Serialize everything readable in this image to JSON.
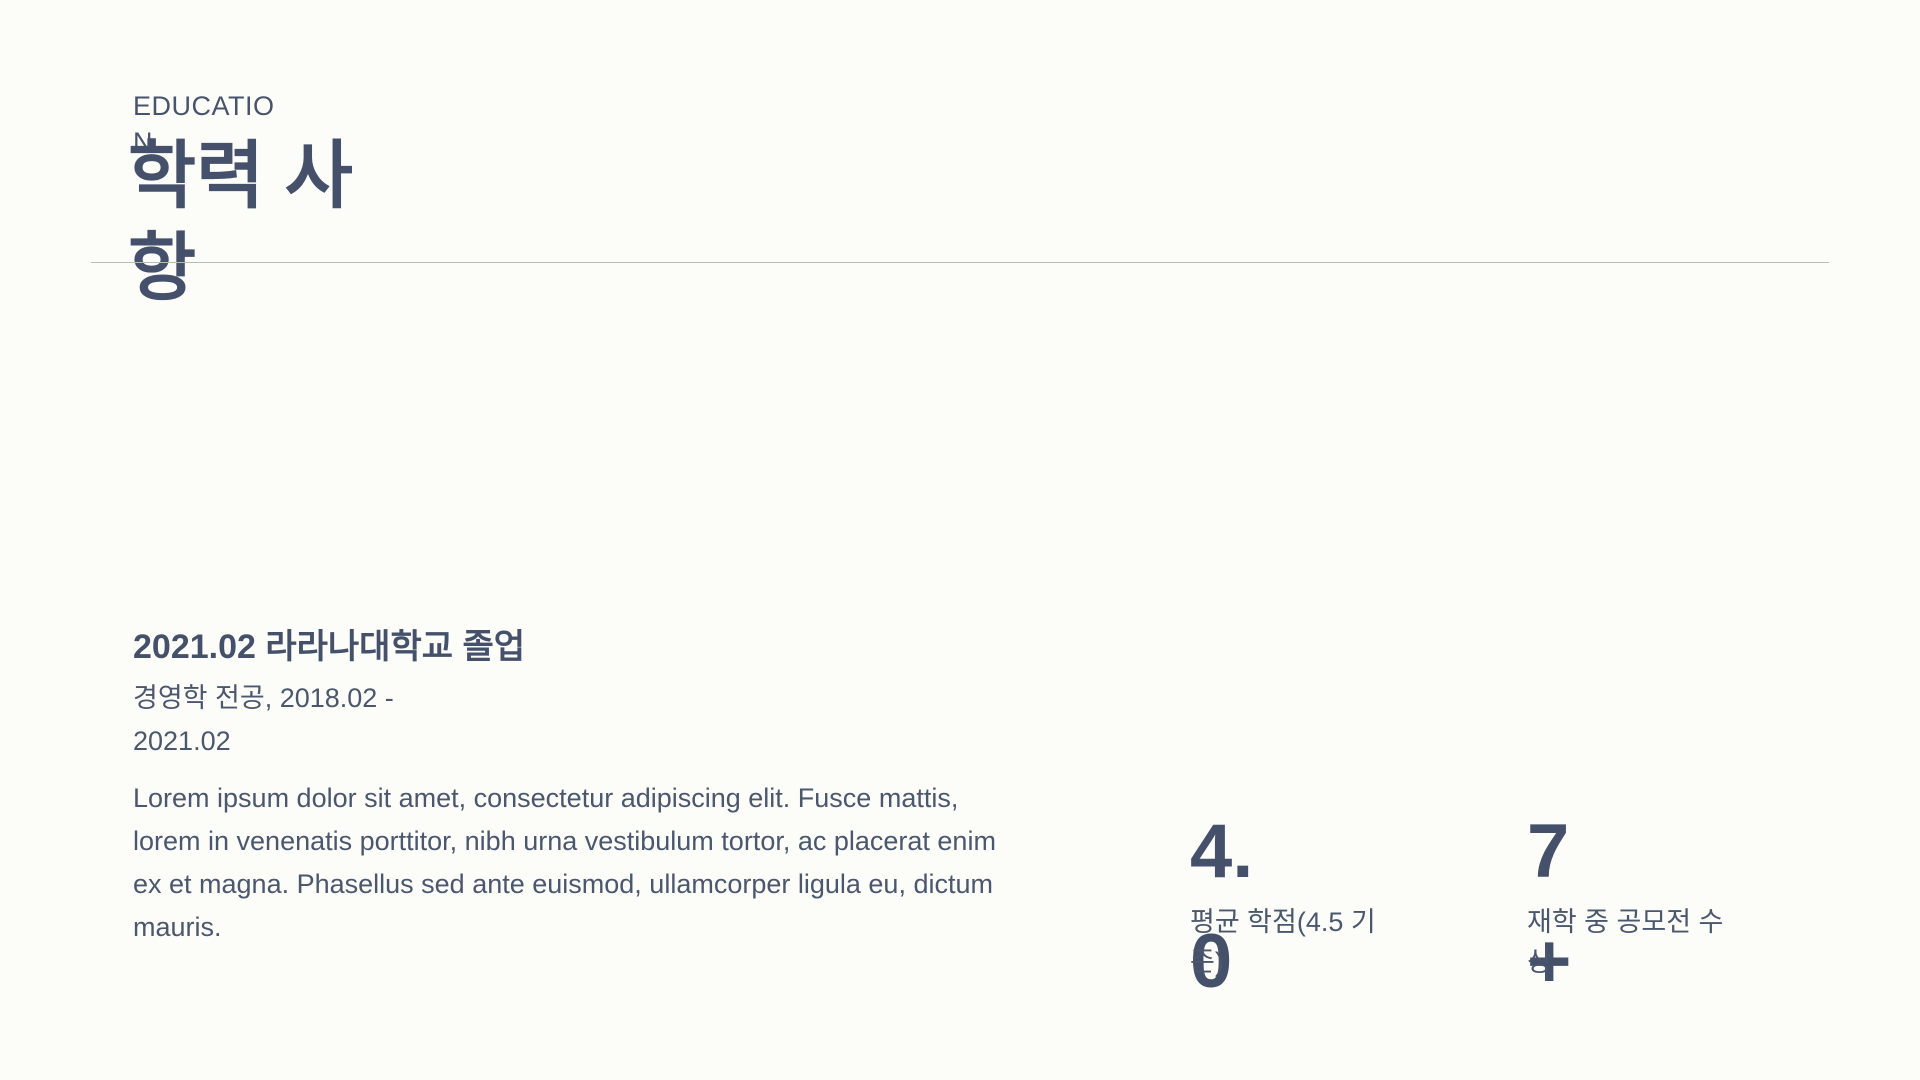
{
  "section": {
    "eyebrow": "EDUCATION",
    "title": "학력 사항"
  },
  "entry": {
    "heading": "2021.02 라라나대학교 졸업",
    "sub": "경영학 전공, 2018.02 - 2021.02",
    "description": "Lorem ipsum dolor sit amet, consectetur adipiscing elit. Fusce mattis, lorem in venenatis porttitor, nibh urna vestibulum tortor, ac placerat enim ex et magna. Phasellus sed ante euismod, ullamcorper ligula eu, dictum mauris."
  },
  "stats": [
    {
      "value": "4.0",
      "label": "평균 학점(4.5 기준)"
    },
    {
      "value": "7+",
      "label": "재학 중 공모전 수상"
    }
  ]
}
